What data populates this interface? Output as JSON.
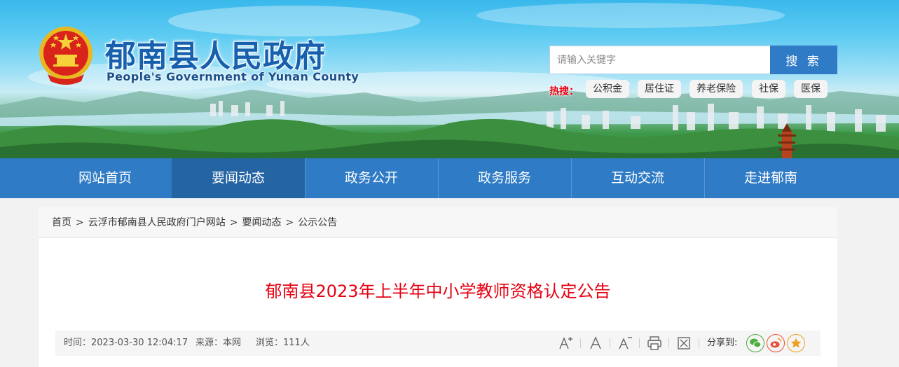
{
  "header": {
    "site_title": "郁南县人民政府",
    "site_subtitle": "People's Government of Yunan County",
    "emblem_icon": "national-emblem-icon"
  },
  "search": {
    "placeholder": "请输入关键字",
    "button_label": "搜 索"
  },
  "hot": {
    "label": "热搜：",
    "tags": [
      "公积金",
      "居住证",
      "养老保险",
      "社保",
      "医保"
    ]
  },
  "nav": {
    "items": [
      "网站首页",
      "要闻动态",
      "政务公开",
      "政务服务",
      "互动交流",
      "走进郁南"
    ],
    "active_index": 1
  },
  "breadcrumb": {
    "items": [
      "首页",
      "云浮市郁南县人民政府门户网站",
      "要闻动态",
      "公示公告"
    ],
    "separator": ">"
  },
  "article": {
    "title": "郁南县2023年上半年中小学教师资格认定公告",
    "time_label": "时间：",
    "time_value": "2023-03-30 12:04:17",
    "source_label": "来源：",
    "source_value": "本网",
    "views_label": "浏览：",
    "views_value": "111人"
  },
  "toolbar": {
    "icons": [
      "font-increase-icon",
      "font-normal-icon",
      "font-decrease-icon",
      "print-icon",
      "close-icon"
    ],
    "share_label": "分享到:",
    "share_icons": [
      "wechat-icon",
      "weibo-icon",
      "favorite-icon"
    ]
  },
  "colors": {
    "primary_blue": "#2f7bc6",
    "nav_active": "#2464a3",
    "title_red": "#e60012",
    "hot_red": "#e60012",
    "wechat_green": "#4cae3c",
    "weibo_red": "#e6533c",
    "favorite_orange": "#f0a020"
  }
}
